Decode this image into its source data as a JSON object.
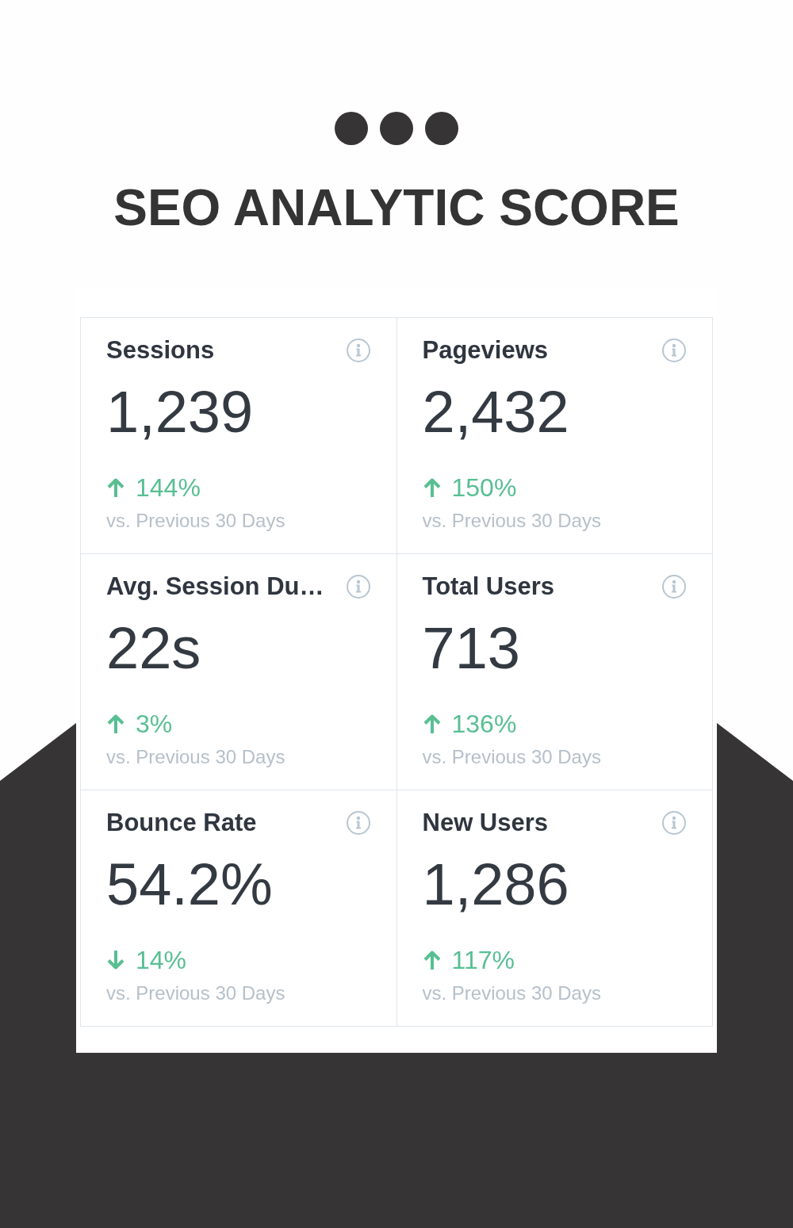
{
  "header": {
    "title": "SEO ANALYTIC SCORE"
  },
  "metrics": [
    {
      "label": "Sessions",
      "value": "1,239",
      "rising": true,
      "change": "144%",
      "comparison": "vs. Previous 30 Days"
    },
    {
      "label": "Pageviews",
      "value": "2,432",
      "rising": true,
      "change": "150%",
      "comparison": "vs. Previous 30 Days"
    },
    {
      "label": "Avg. Session Du…",
      "value": "22s",
      "rising": true,
      "change": "3%",
      "comparison": "vs. Previous 30 Days"
    },
    {
      "label": "Total Users",
      "value": "713",
      "rising": true,
      "change": "136%",
      "comparison": "vs. Previous 30 Days"
    },
    {
      "label": "Bounce Rate",
      "value": "54.2%",
      "rising": false,
      "change": "14%",
      "comparison": "vs. Previous 30 Days"
    },
    {
      "label": "New Users",
      "value": "1,286",
      "rising": true,
      "change": "117%",
      "comparison": "vs. Previous 30 Days"
    }
  ]
}
